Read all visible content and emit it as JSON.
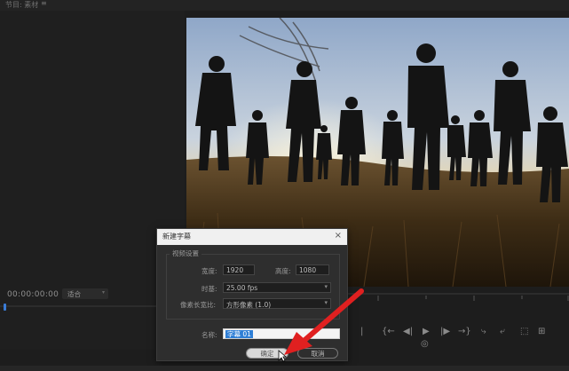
{
  "panel": {
    "tab_label": "节目: 素材",
    "menu_icon": "≡"
  },
  "source": {
    "timecode": "00:00:00:00",
    "zoom_select": "适合"
  },
  "program": {
    "controls": [
      "|",
      "{←",
      "◀|",
      "▶",
      "|▶",
      "→}",
      "⤷",
      "⤶",
      "⬚",
      "◎",
      "⊞"
    ]
  },
  "dialog": {
    "title": "新建字幕",
    "close_icon": "×",
    "video_settings_label": "视频设置",
    "width_label": "宽度:",
    "width_value": "1920",
    "height_label": "高度:",
    "height_value": "1080",
    "timebase_label": "时基:",
    "timebase_value": "25.00 fps",
    "pixel_aspect_label": "像素长宽比:",
    "pixel_aspect_value": "方形像素 (1.0)",
    "name_label": "名称:",
    "name_value": "字幕 01",
    "ok_label": "确定",
    "cancel_label": "取消"
  },
  "colors": {
    "accent": "#2f7fd6",
    "arrow": "#e02020",
    "background": "#1d1d1d"
  }
}
